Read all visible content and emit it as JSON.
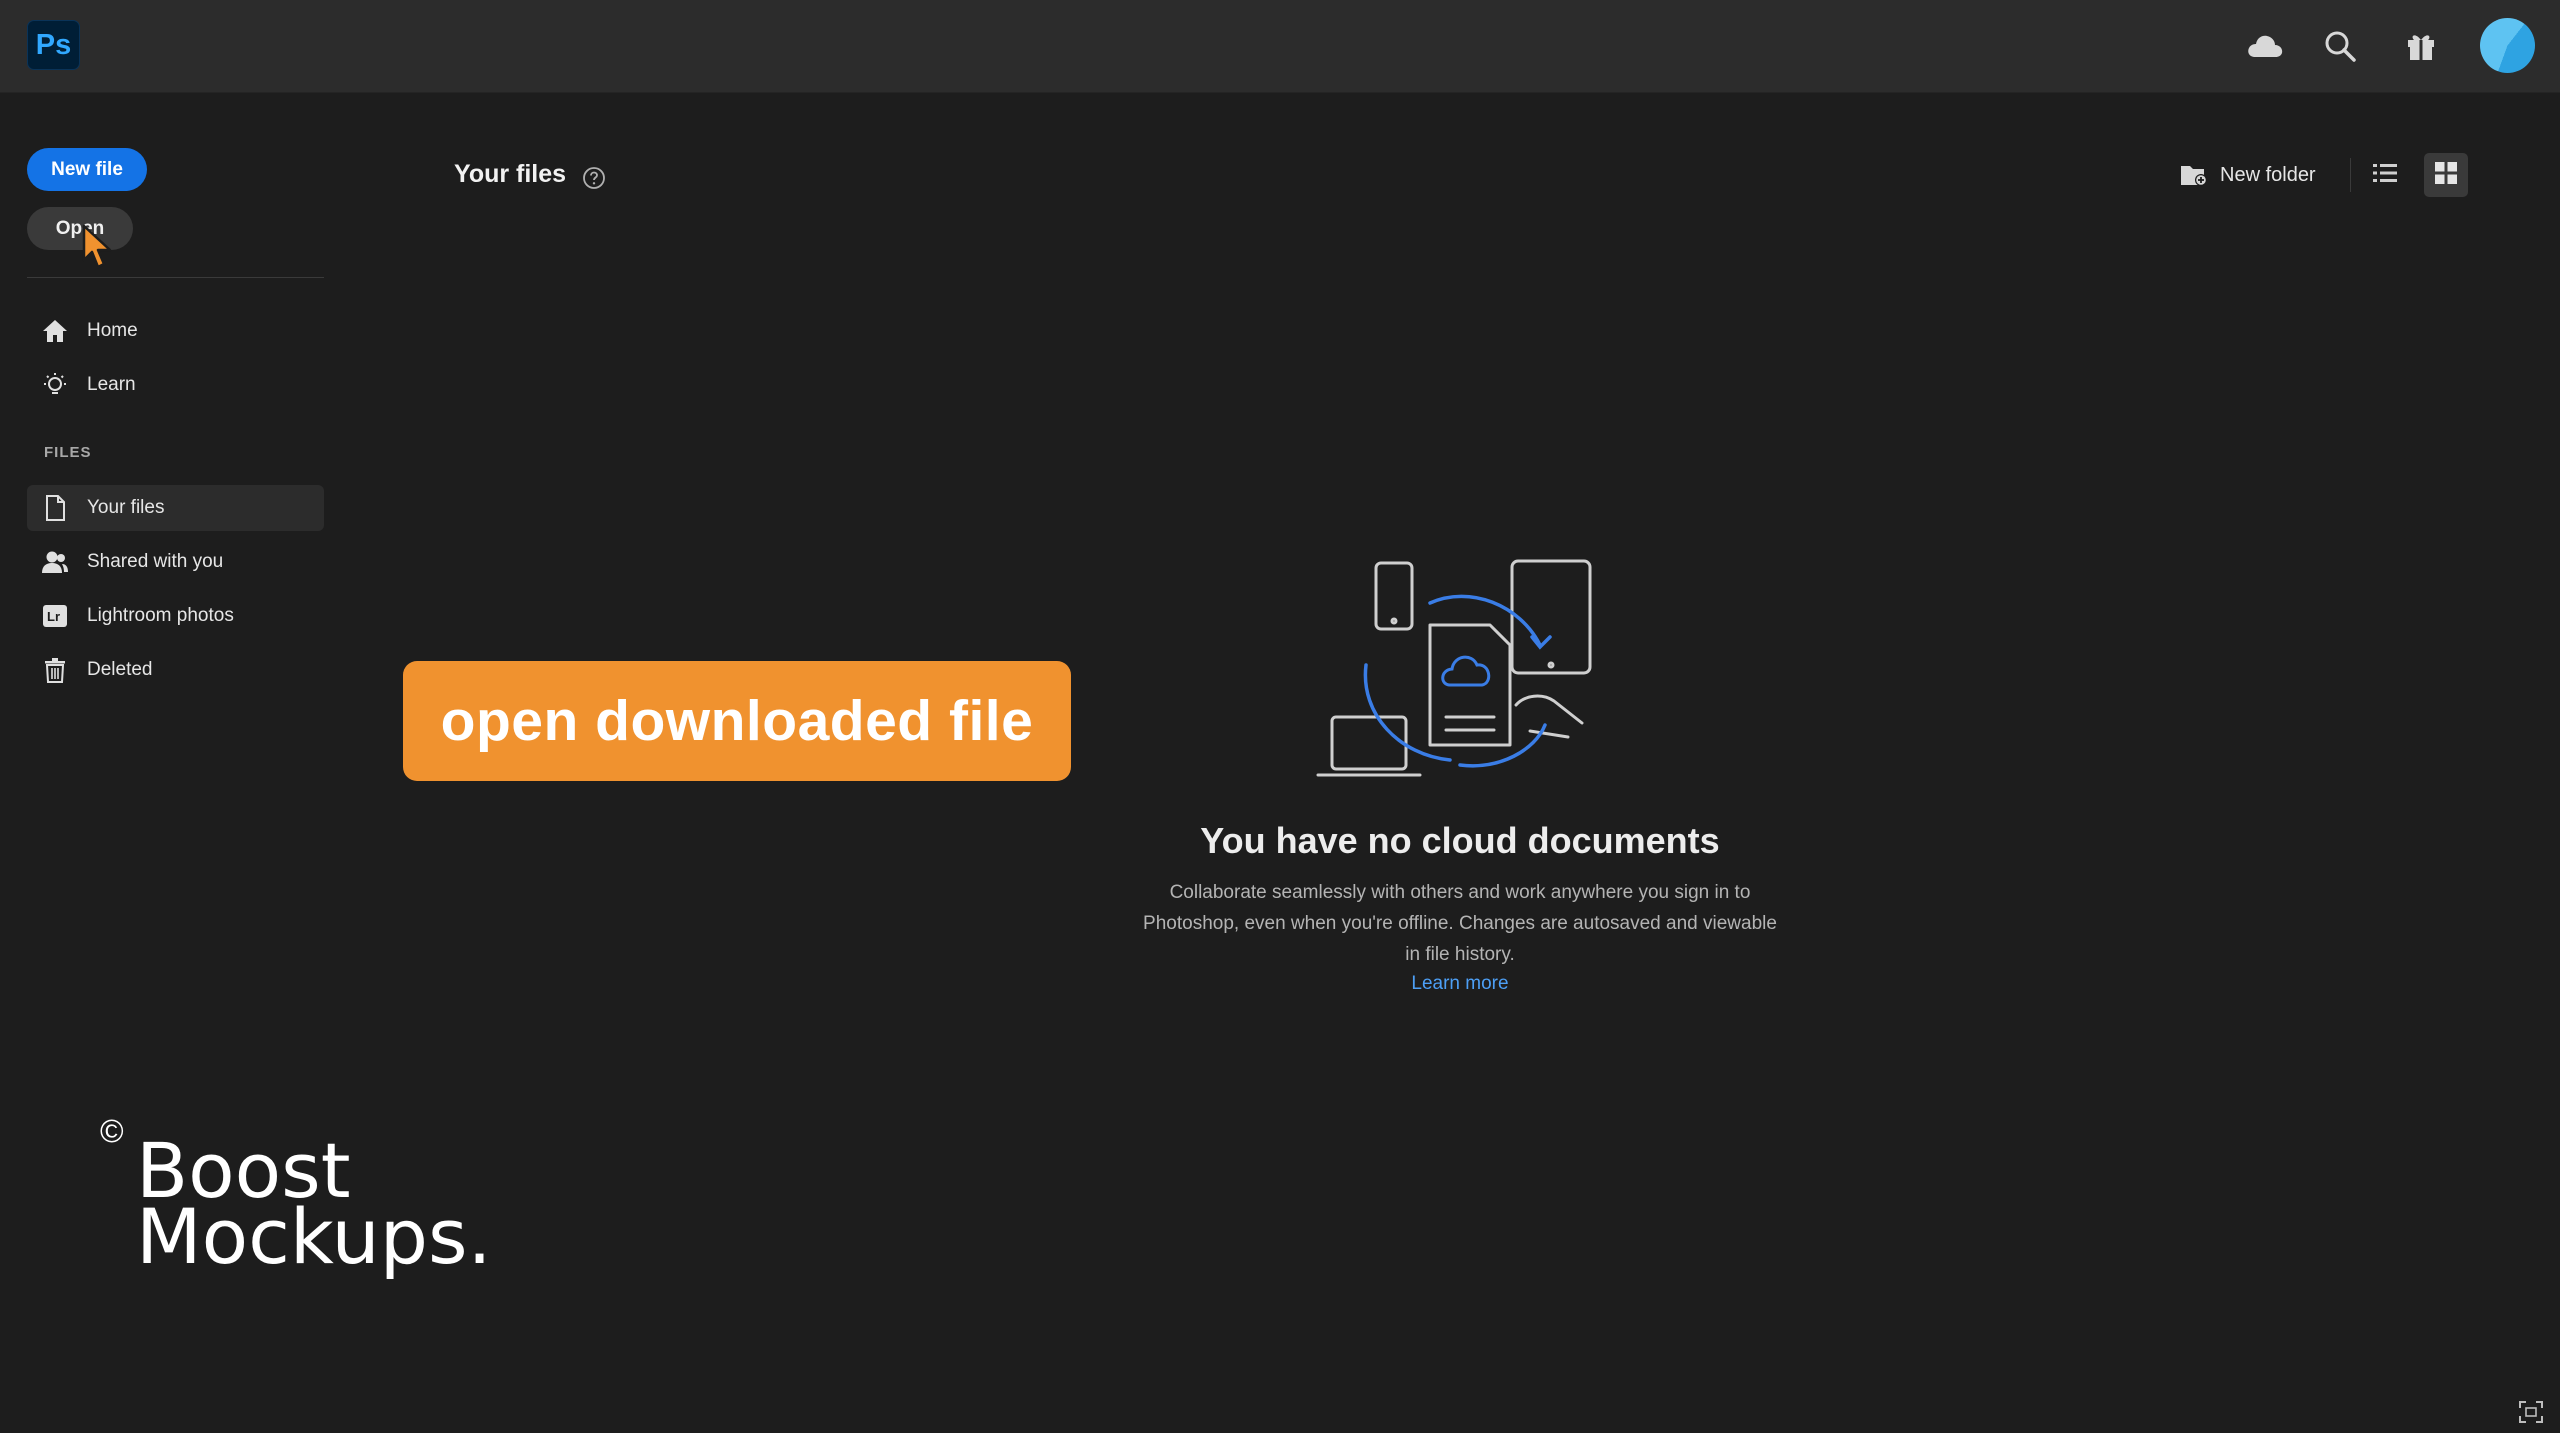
{
  "app": {
    "logo_text": "Ps",
    "accent": "#1473e6"
  },
  "topbar": {
    "icons": [
      "cloud-icon",
      "search-icon",
      "gift-icon"
    ],
    "avatar_color": "#5ec3f2"
  },
  "sidebar": {
    "new_file_label": "New file",
    "open_label": "Open",
    "nav": [
      {
        "label": "Home",
        "icon": "home-icon"
      },
      {
        "label": "Learn",
        "icon": "lightbulb-icon"
      }
    ],
    "files_section_label": "FILES",
    "files": [
      {
        "label": "Your files",
        "icon": "file-icon",
        "active": true
      },
      {
        "label": "Shared with you",
        "icon": "people-icon",
        "active": false
      },
      {
        "label": "Lightroom photos",
        "icon": "lightroom-icon",
        "active": false
      },
      {
        "label": "Deleted",
        "icon": "trash-icon",
        "active": false
      }
    ]
  },
  "main": {
    "title": "Your files",
    "new_folder_label": "New folder",
    "views": [
      "list-view-icon",
      "grid-view-icon"
    ],
    "active_view": "grid",
    "empty_state": {
      "title": "You have no cloud documents",
      "description": "Collaborate seamlessly with others and work anywhere you sign in to Photoshop, even when you're offline. Changes are autosaved and viewable in file history.",
      "link": "Learn more"
    }
  },
  "overlay": {
    "banner_text": "open downloaded file",
    "banner_color": "#f0922f"
  },
  "watermark": {
    "copyright": "©",
    "line1": "Boost",
    "line2": "Mockups."
  }
}
